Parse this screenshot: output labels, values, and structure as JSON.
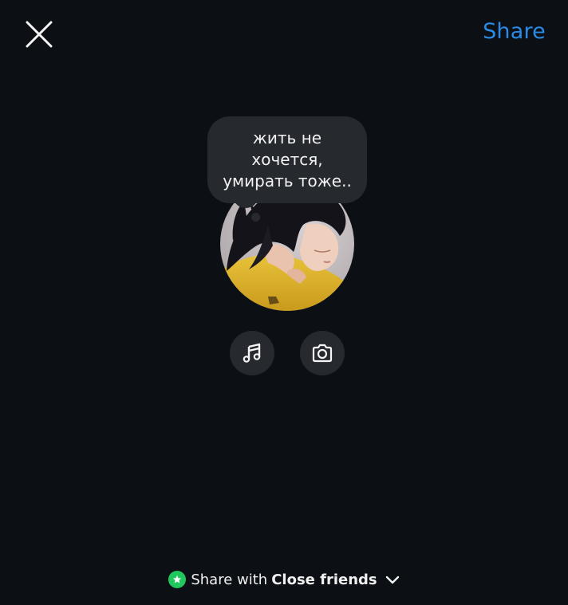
{
  "header": {
    "close_icon": "close-icon",
    "share_label": "Share"
  },
  "note": {
    "text": "жить не\nхочется,\nумирать тоже.."
  },
  "actions": {
    "music_icon": "music-note-icon",
    "camera_icon": "camera-icon"
  },
  "audience": {
    "prefix": "Share with",
    "group": "Close friends",
    "badge_icon": "star-icon",
    "dropdown_icon": "chevron-down-icon",
    "badge_color": "#1fc75d"
  },
  "colors": {
    "background": "#0c1014",
    "accent": "#2a8ae6",
    "bubble": "#262a2f"
  }
}
